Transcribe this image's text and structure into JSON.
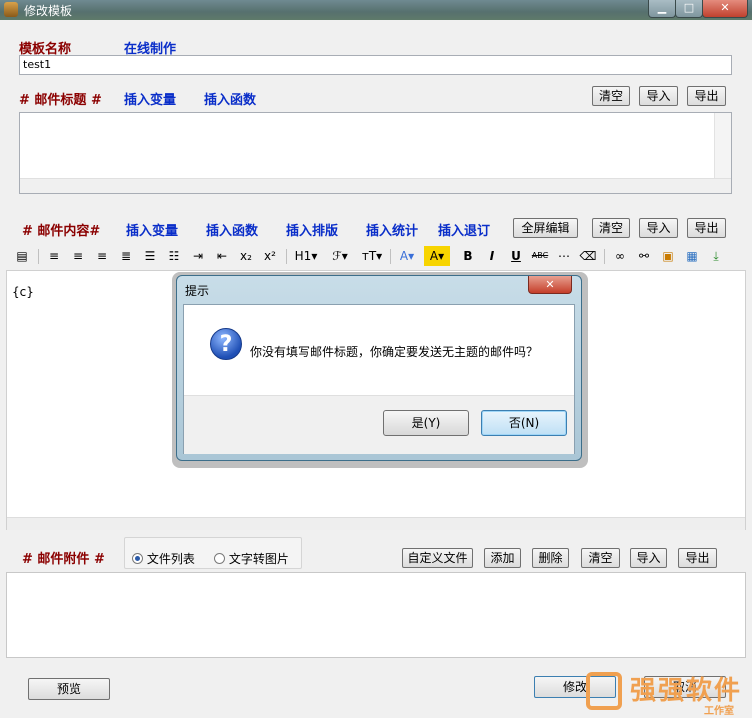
{
  "window": {
    "title": "修改模板",
    "min": "▁",
    "max": "□",
    "close": "✕"
  },
  "template_name": {
    "label": "模板名称",
    "online_label": "在线制作",
    "value": "test1"
  },
  "subject": {
    "label": "# 邮件标题 #",
    "insert_var": "插入变量",
    "insert_func": "插入函数",
    "clear": "清空",
    "import": "导入",
    "export": "导出"
  },
  "content": {
    "label": "# 邮件内容#",
    "insert_var": "插入变量",
    "insert_func": "插入函数",
    "insert_layout": "插入排版",
    "insert_stats": "插入统计",
    "insert_unsub": "插入退订",
    "fullscreen": "全屏编辑",
    "clear": "清空",
    "import": "导入",
    "export": "导出",
    "body_text": "{c}"
  },
  "toolbar": {
    "h1": "H1▾",
    "font": "ℱ▾",
    "size": "тT▾",
    "font_color": "A▾",
    "highlight": "A▾",
    "bold": "B",
    "italic": "I",
    "underline": "U",
    "strike": "ABC",
    "sub": "x₂",
    "sup": "x²"
  },
  "attachments": {
    "label": "# 邮件附件 #",
    "radio_list": "文件列表",
    "radio_img": "文字转图片",
    "custom": "自定义文件",
    "add": "添加",
    "delete": "删除",
    "clear": "清空",
    "import": "导入",
    "export": "导出"
  },
  "footer": {
    "preview": "预览",
    "modify": "修改",
    "cancel": "取消"
  },
  "dialog": {
    "title": "提示",
    "message": "你没有填写邮件标题，你确定要发送无主题的邮件吗？",
    "yes": "是(Y)",
    "no": "否(N)",
    "close": "✕"
  },
  "watermark": {
    "text": "强强软件",
    "sub": "工作室"
  }
}
